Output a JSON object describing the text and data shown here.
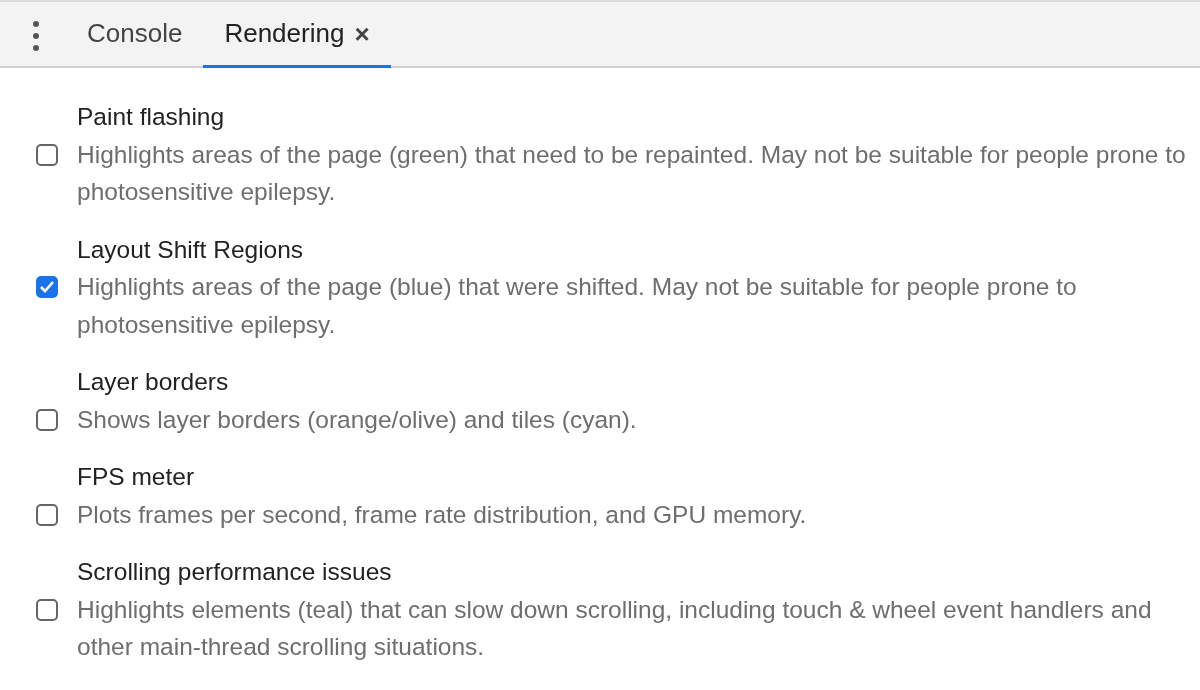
{
  "tabs": [
    {
      "label": "Console",
      "selected": false
    },
    {
      "label": "Rendering",
      "selected": true,
      "close": "×"
    }
  ],
  "options": [
    {
      "title": "Paint flashing",
      "description": "Highlights areas of the page (green) that need to be repainted. May not be suitable for people prone to photosensitive epilepsy.",
      "checked": false
    },
    {
      "title": "Layout Shift Regions",
      "description": "Highlights areas of the page (blue) that were shifted. May not be suitable for people prone to photosensitive epilepsy.",
      "checked": true
    },
    {
      "title": "Layer borders",
      "description": "Shows layer borders (orange/olive) and tiles (cyan).",
      "checked": false
    },
    {
      "title": "FPS meter",
      "description": "Plots frames per second, frame rate distribution, and GPU memory.",
      "checked": false
    },
    {
      "title": "Scrolling performance issues",
      "description": "Highlights elements (teal) that can slow down scrolling, including touch & wheel event handlers and other main-thread scrolling situations.",
      "checked": false
    }
  ]
}
